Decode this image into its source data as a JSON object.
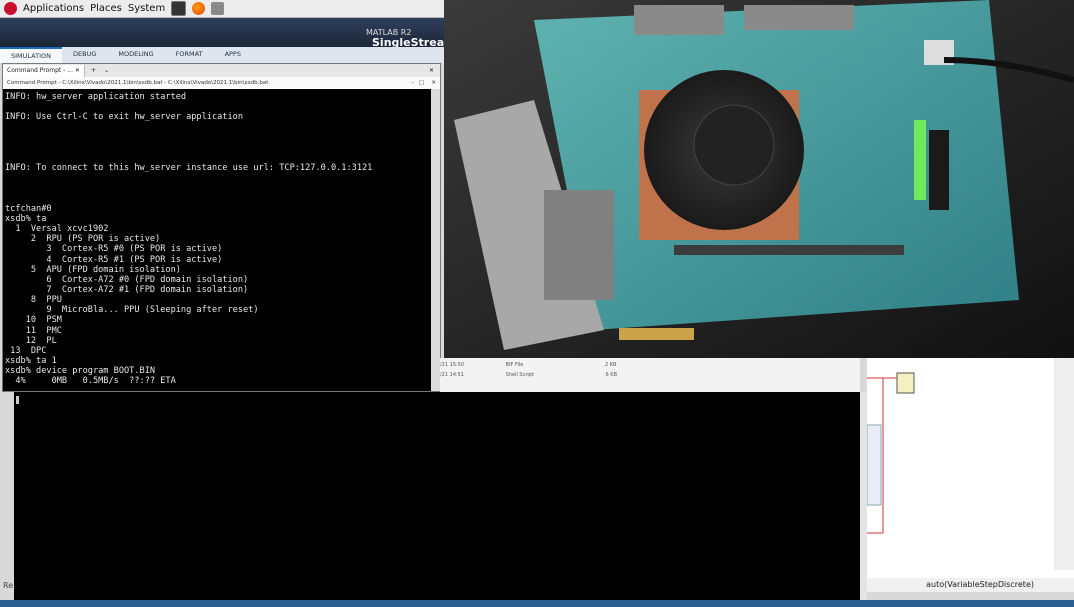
{
  "top_panel": {
    "applications": "Applications",
    "places": "Places",
    "system": "System"
  },
  "matlab": {
    "title_a": "MATLAB R2",
    "title_b": "SingleStreamSS",
    "tabs": [
      "SIMULATION",
      "DEBUG",
      "MODELING",
      "FORMAT",
      "APPS"
    ],
    "status": "auto(VariableStepDiscrete)",
    "left_label": "Re"
  },
  "file_list": {
    "rows": [
      {
        "date": "/21 15:50",
        "type": "BIF File",
        "size": "2 KB"
      },
      {
        "date": "/21 14:51",
        "type": "Shell Script",
        "size": "6 KB"
      }
    ]
  },
  "cmd": {
    "tab_label": "Command Prompt - ...",
    "title": "Command Prompt - C:\\Xilinx\\Vivado\\2021.1\\bin\\xsdb.bat - C:\\Xilinx\\Vivado\\2021.1\\bin\\xsdb.bat",
    "output": "INFO: hw_server application started\n\nINFO: Use Ctrl-C to exit hw_server application\n\n\n\n\nINFO: To connect to this hw_server instance use url: TCP:127.0.0.1:3121\n\n\n\ntcfchan#0\nxsdb% ta\n  1  Versal xcvc1902\n     2  RPU (PS POR is active)\n        3  Cortex-R5 #0 (PS POR is active)\n        4  Cortex-R5 #1 (PS POR is active)\n     5  APU (FPD domain isolation)\n        6  Cortex-A72 #0 (FPD domain isolation)\n        7  Cortex-A72 #1 (FPD domain isolation)\n     8  PPU\n        9  MicroBla... PPU (Sleeping after reset)\n    10  PSM\n    11  PMC\n    12  PL\n 13  DPC\nxsdb% ta 1\nxsdb% device program BOOT.BIN\n  4%     0MB   0.5MB/s  ??:?? ETA"
  },
  "colors": {
    "terminal_bg": "#000000",
    "terminal_fg": "#e8e8e8",
    "matlab_title": "#1c2638",
    "tab_active_accent": "#1a6cc0"
  }
}
